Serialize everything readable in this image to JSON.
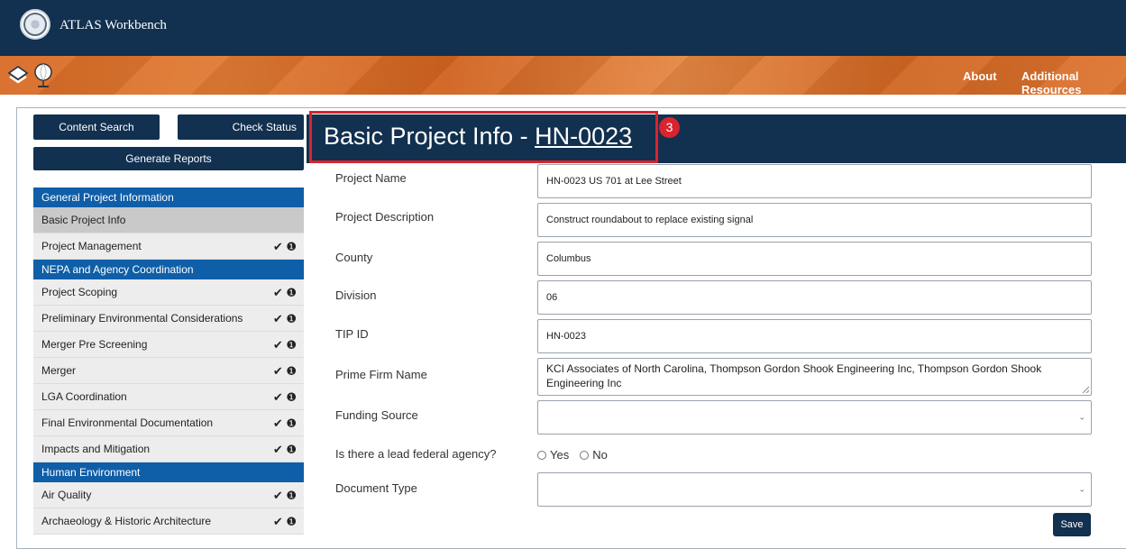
{
  "app": {
    "title": "ATLAS Workbench"
  },
  "topnav": {
    "about": "About",
    "additional_resources": "Additional Resources"
  },
  "sidebar": {
    "content_search": "Content Search",
    "check_status": "Check Status",
    "generate_reports": "Generate Reports",
    "sections": [
      {
        "heading": "General Project Information",
        "items": [
          {
            "label": "Basic Project Info",
            "active": true,
            "marks": ""
          },
          {
            "label": "Project Management",
            "active": false,
            "marks": "✔ ❶"
          }
        ]
      },
      {
        "heading": "NEPA and Agency Coordination",
        "items": [
          {
            "label": "Project Scoping",
            "marks": "✔ ❶"
          },
          {
            "label": "Preliminary Environmental Considerations",
            "marks": "✔ ❶"
          },
          {
            "label": "Merger Pre Screening",
            "marks": "✔ ❶"
          },
          {
            "label": "Merger",
            "marks": "✔ ❶"
          },
          {
            "label": "LGA Coordination",
            "marks": "✔ ❶"
          },
          {
            "label": "Final Environmental Documentation",
            "marks": "✔ ❶"
          },
          {
            "label": "Impacts and Mitigation",
            "marks": "✔ ❶"
          }
        ]
      },
      {
        "heading": "Human Environment",
        "items": [
          {
            "label": "Air Quality",
            "marks": "✔ ❶"
          },
          {
            "label": "Archaeology & Historic Architecture",
            "marks": "✔ ❶"
          }
        ]
      }
    ]
  },
  "main": {
    "title_prefix": "Basic Project Info - ",
    "title_code": "HN-0023",
    "step_badge": "3",
    "fields": {
      "project_name": {
        "label": "Project Name",
        "value": "HN-0023 US 701 at Lee Street"
      },
      "project_description": {
        "label": "Project Description",
        "value": "Construct roundabout to replace existing signal"
      },
      "county": {
        "label": "County",
        "value": "Columbus"
      },
      "division": {
        "label": "Division",
        "value": "06"
      },
      "tip_id": {
        "label": "TIP ID",
        "value": "HN-0023"
      },
      "prime_firm_name": {
        "label": "Prime Firm Name",
        "value": "KCI Associates of North Carolina, Thompson Gordon Shook Engineering Inc, Thompson Gordon Shook Engineering Inc"
      },
      "funding_source": {
        "label": "Funding Source",
        "value": ""
      },
      "lead_federal_agency": {
        "label": "Is there a lead federal agency?",
        "yes": "Yes",
        "no": "No"
      },
      "document_type": {
        "label": "Document Type",
        "value": ""
      }
    },
    "save": "Save"
  }
}
